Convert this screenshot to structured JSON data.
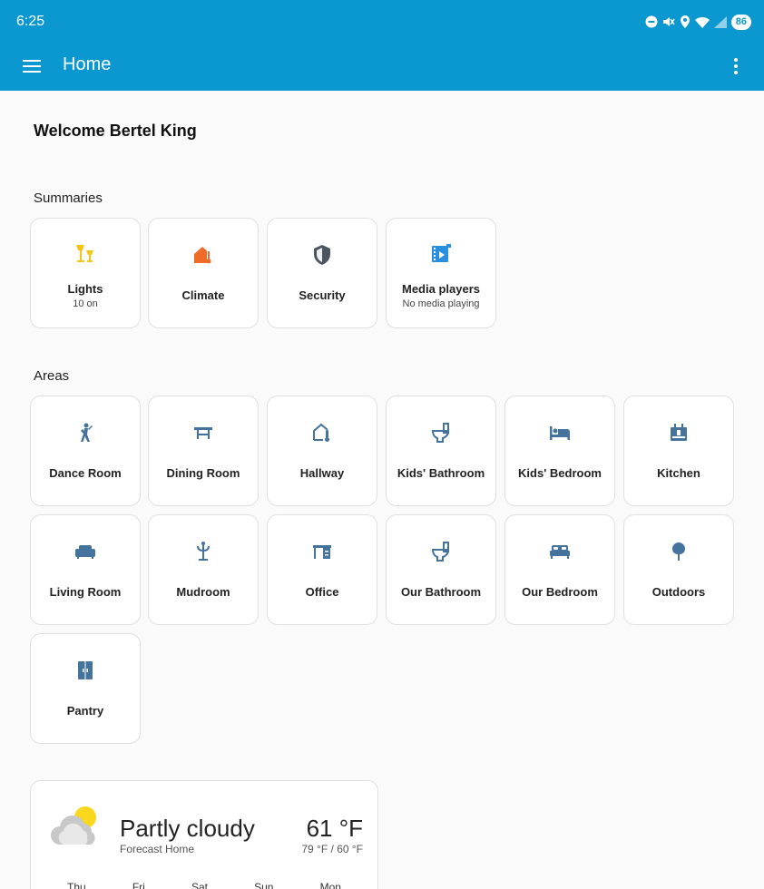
{
  "status_bar": {
    "time": "6:25",
    "battery": "86",
    "icons": [
      "dnd-icon",
      "mute-icon",
      "location-icon",
      "wifi-icon",
      "signal-icon"
    ]
  },
  "app_bar": {
    "title": "Home",
    "menu_icon": "menu-icon",
    "more_icon": "more-vert-icon",
    "background": "#0b97cf"
  },
  "welcome": "Welcome Bertel King",
  "summaries": {
    "title": "Summaries",
    "cards": [
      {
        "label": "Lights",
        "sub": "10 on",
        "icon": "lamp-icon",
        "color": "#f5c518"
      },
      {
        "label": "Climate",
        "icon": "home-thermometer-icon",
        "color": "#ef6c28"
      },
      {
        "label": "Security",
        "icon": "shield-icon",
        "color": "#4a5560"
      },
      {
        "label": "Media players",
        "sub": "No media playing",
        "icon": "multimedia-icon",
        "color": "#2a8fe0"
      }
    ]
  },
  "areas": {
    "title": "Areas",
    "cards": [
      {
        "label": "Dance Room",
        "icon": "dance-icon"
      },
      {
        "label": "Dining Room",
        "icon": "table-icon"
      },
      {
        "label": "Hallway",
        "icon": "home-thermometer-outline-icon"
      },
      {
        "label": "Kids' Bathroom",
        "icon": "toilet-icon"
      },
      {
        "label": "Kids' Bedroom",
        "icon": "bed-icon"
      },
      {
        "label": "Kitchen",
        "icon": "stove-icon"
      },
      {
        "label": "Living Room",
        "icon": "sofa-icon"
      },
      {
        "label": "Mudroom",
        "icon": "coat-rack-icon"
      },
      {
        "label": "Office",
        "icon": "desk-icon"
      },
      {
        "label": "Our Bathroom",
        "icon": "toilet-icon"
      },
      {
        "label": "Our Bedroom",
        "icon": "bed-double-icon"
      },
      {
        "label": "Outdoors",
        "icon": "tree-icon"
      },
      {
        "label": "Pantry",
        "icon": "cupboard-icon"
      }
    ],
    "icon_color": "#44739e"
  },
  "weather": {
    "condition": "Partly cloudy",
    "source": "Forecast Home",
    "temperature": "61 °F",
    "high_low": "79 °F / 60 °F",
    "icon": "partly-cloudy-icon",
    "days": [
      "Thu",
      "Fri",
      "Sat",
      "Sun",
      "Mon"
    ]
  }
}
